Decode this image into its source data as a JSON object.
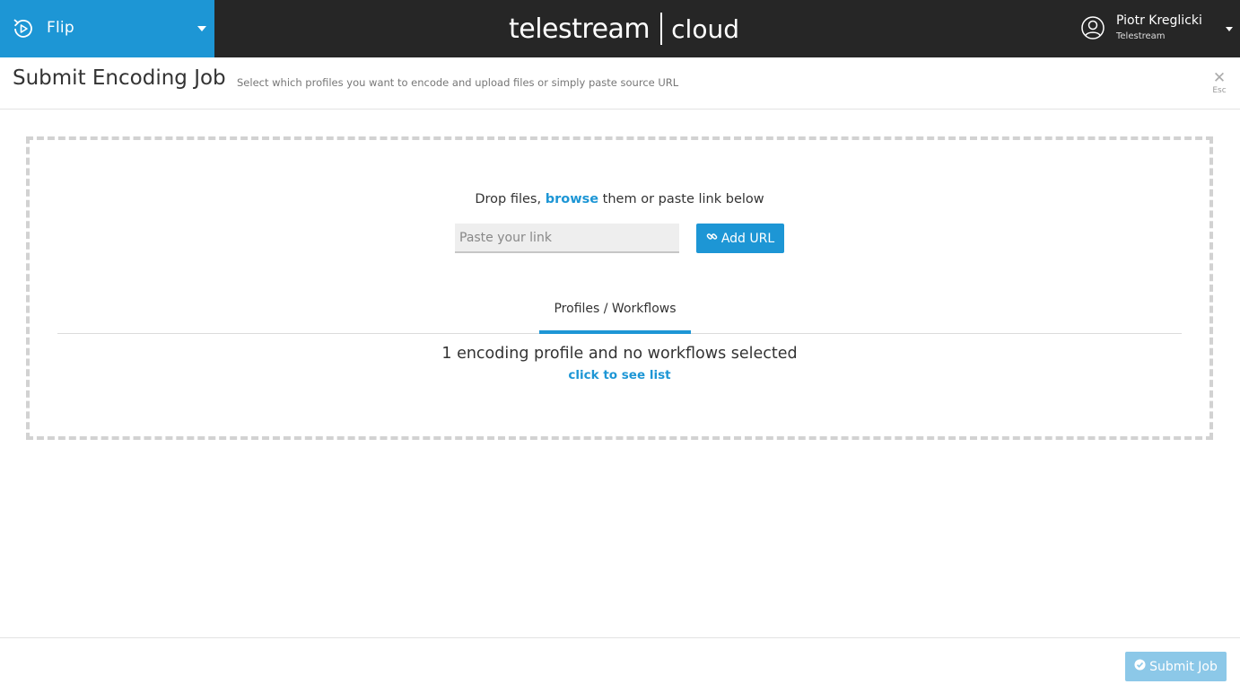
{
  "topbar": {
    "app_name": "Flip",
    "logo_brand": "telestream",
    "logo_product": "cloud",
    "user_name": "Piotr Kreglicki",
    "user_org": "Telestream"
  },
  "header": {
    "title": "Submit Encoding Job",
    "subtitle": "Select which profiles you want to encode and upload files or simply paste source URL",
    "close_label": "Esc"
  },
  "dropzone": {
    "text_before": "Drop files, ",
    "browse_link": "browse",
    "text_after": " them or paste link below",
    "url_placeholder": "Paste your link",
    "add_url_label": "Add URL",
    "tab_label": "Profiles / Workflows",
    "selection_summary": "1 encoding profile and no workflows selected",
    "see_list_link": "click to see list"
  },
  "footer": {
    "submit_label": "Submit Job"
  },
  "colors": {
    "accent": "#1d96d5",
    "topbar_bg": "#262626",
    "submit_disabled": "#8cc8e8"
  },
  "icons": {
    "app": "play-refresh-icon",
    "user": "user-circle-icon",
    "link": "link-icon",
    "submit": "check-circle-icon",
    "close": "close-icon"
  }
}
